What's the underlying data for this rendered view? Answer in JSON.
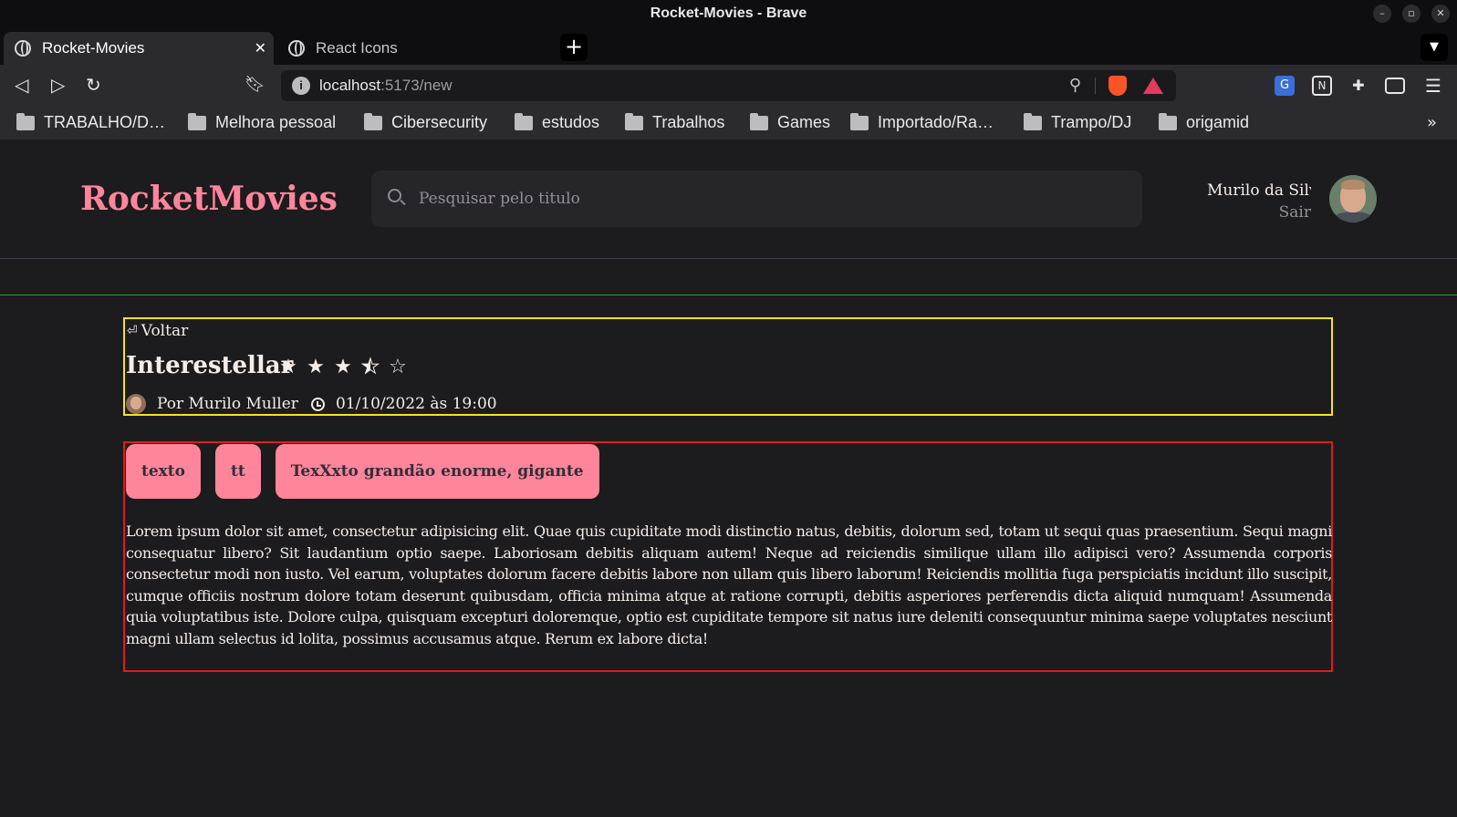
{
  "window": {
    "title": "Rocket-Movies - Brave"
  },
  "tabs": [
    {
      "label": "Rocket-Movies",
      "active": true
    },
    {
      "label": "React Icons",
      "active": false
    }
  ],
  "address_bar": {
    "host": "localhost",
    "path": ":5173/new"
  },
  "bookmarks": [
    "TRABALHO/D…",
    "Melhora pessoal",
    "Cibersecurity",
    "estudos",
    "Trabalhos",
    "Games",
    "Importado/Ra…",
    "Trampo/DJ",
    "origamid"
  ],
  "header": {
    "brand": "RocketMovies",
    "search_placeholder": "Pesquisar pelo titulo",
    "user_name": "Murilo da Silva",
    "logout": "Sair"
  },
  "movie": {
    "back_label": "Voltar",
    "title": "Interestellar",
    "rating": 3.5,
    "rating_max": 5,
    "author": "Por Murilo Muller",
    "date": "01/10/2022 às 19:00",
    "tags": [
      "texto",
      "tt",
      "TexXxto grandão enorme, gigante"
    ],
    "description": "Lorem ipsum dolor sit amet, consectetur adipisicing elit. Quae quis cupiditate modi distinctio natus, debitis, dolorum sed, totam ut sequi quas praesentium. Sequi magni consequatur libero? Sit laudantium optio saepe. Laboriosam debitis aliquam autem! Neque ad reiciendis similique ullam illo adipisci vero? Assumenda corporis consectetur modi non iusto. Vel earum, voluptates dolorum facere debitis labore non ullam quis libero laborum! Reiciendis mollitia fuga perspiciatis incidunt illo suscipit, cumque officiis nostrum dolore totam deserunt quibusdam, officia minima atque at ratione corrupti, debitis asperiores perferendis dicta aliquid numquam! Assumenda quia voluptatibus iste. Dolore culpa, quisquam excepturi doloremque, optio est cupiditate tempore sit natus iure deleniti consequuntur minima saepe voluptates nesciunt magni ullam selectus id lolita, possimus accusamus atque. Rerum ex labore dicta!"
  },
  "colors": {
    "brand_pink": "#ff859b",
    "background": "#1c1b1e",
    "outline_yellow": "#f5e41e",
    "outline_red": "#e01b1b",
    "divider_green": "#2ca035"
  }
}
